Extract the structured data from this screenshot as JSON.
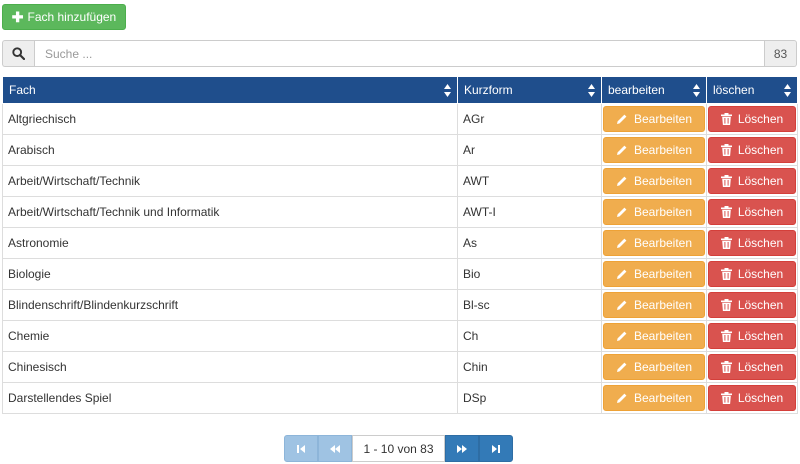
{
  "toolbar": {
    "add_label": "Fach hinzufügen"
  },
  "search": {
    "placeholder": "Suche ...",
    "count": "83"
  },
  "table": {
    "headers": {
      "fach": "Fach",
      "kurzform": "Kurzform",
      "bearbeiten": "bearbeiten",
      "loeschen": "löschen"
    },
    "edit_label": "Bearbeiten",
    "delete_label": "Löschen",
    "rows": [
      {
        "fach": "Altgriechisch",
        "kurzform": "AGr"
      },
      {
        "fach": "Arabisch",
        "kurzform": "Ar"
      },
      {
        "fach": "Arbeit/Wirtschaft/Technik",
        "kurzform": "AWT"
      },
      {
        "fach": "Arbeit/Wirtschaft/Technik und Informatik",
        "kurzform": "AWT-I"
      },
      {
        "fach": "Astronomie",
        "kurzform": "As"
      },
      {
        "fach": "Biologie",
        "kurzform": "Bio"
      },
      {
        "fach": "Blindenschrift/Blindenkurzschrift",
        "kurzform": "Bl-sc"
      },
      {
        "fach": "Chemie",
        "kurzform": "Ch"
      },
      {
        "fach": "Chinesisch",
        "kurzform": "Chin"
      },
      {
        "fach": "Darstellendes Spiel",
        "kurzform": "DSp"
      }
    ]
  },
  "pagination": {
    "info": "1 - 10 von 83"
  },
  "colors": {
    "add": "#5cb85c",
    "header": "#1f4e8c",
    "edit": "#f0ad4e",
    "delete": "#d9534f",
    "pager": "#337ab7"
  }
}
